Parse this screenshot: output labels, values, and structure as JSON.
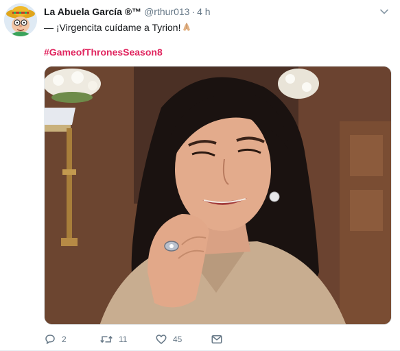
{
  "tweet": {
    "author_name": "La Abuela García ®™",
    "handle": "@rthur013",
    "separator": "·",
    "time": "4 h",
    "text": "— ¡Virgencita cuídame a Tyrion!",
    "hashtag": "#GameofThronesSeason8",
    "media_icon": "photo",
    "caret_icon": "chevron-down-icon"
  },
  "actions": {
    "reply_count": "2",
    "retweet_count": "11",
    "like_count": "45"
  },
  "colors": {
    "hashtag": "#e0245e",
    "muted": "#657786",
    "text": "#14171a"
  }
}
